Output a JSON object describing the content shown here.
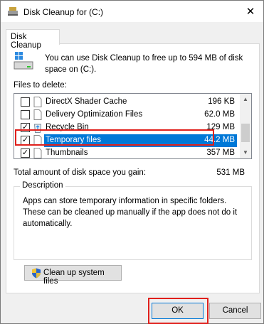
{
  "window": {
    "title": "Disk Cleanup for  (C:)",
    "close_glyph": "✕"
  },
  "tab": {
    "label": "Disk Cleanup"
  },
  "intro": {
    "text": "You can use Disk Cleanup to free up to 594 MB of disk space on  (C:)."
  },
  "files": {
    "label": "Files to delete:",
    "rows": [
      {
        "name": "DirectX Shader Cache",
        "size": "196 KB",
        "checked": false,
        "icon": "file-icon"
      },
      {
        "name": "Delivery Optimization Files",
        "size": "62.0 MB",
        "checked": false,
        "icon": "file-icon"
      },
      {
        "name": "Recycle Bin",
        "size": "129 MB",
        "checked": true,
        "icon": "recycle-bin-icon"
      },
      {
        "name": "Temporary files",
        "size": "44.2 MB",
        "checked": true,
        "icon": "file-icon",
        "selected": true
      },
      {
        "name": "Thumbnails",
        "size": "357 MB",
        "checked": true,
        "icon": "file-icon"
      }
    ],
    "check_glyph": "✓"
  },
  "total": {
    "label": "Total amount of disk space you gain:",
    "value": "531 MB"
  },
  "description": {
    "title": "Description",
    "text": "Apps can store temporary information in specific folders. These can be cleaned up manually if the app does not do it automatically."
  },
  "buttons": {
    "cleanup": "Clean up system files",
    "ok": "OK",
    "cancel": "Cancel"
  },
  "colors": {
    "selection": "#0078d7",
    "highlight_box": "#e0201c"
  }
}
